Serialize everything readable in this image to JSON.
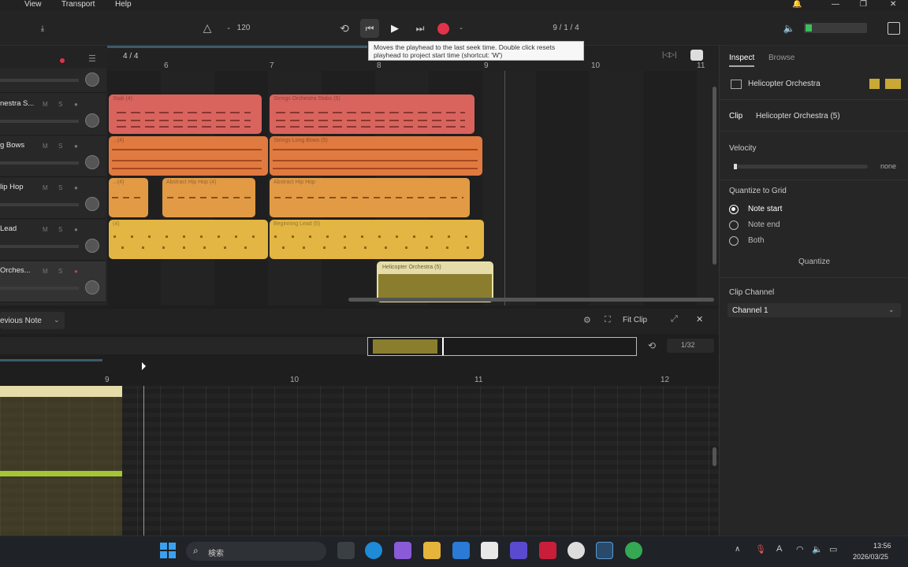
{
  "menu": [
    "View",
    "Transport",
    "Help"
  ],
  "toolbar": {
    "tempo": "120",
    "position": "9  /  1  /  4",
    "fit_clip": "Fit Clip",
    "time_sig": "4 / 4"
  },
  "tooltip": "Moves the playhead to the last seek time. Double click resets playhead to project start time (shortcut: 'W')",
  "ruler_marks": [
    "6",
    "7",
    "8",
    "9",
    "10",
    "11"
  ],
  "tracks": [
    {
      "name": "",
      "color": "#d46060"
    },
    {
      "name": "nestra S...",
      "color": "#d46060"
    },
    {
      "name": "g Bows",
      "color": "#e07a40"
    },
    {
      "name": "lip Hop",
      "color": "#e5953e"
    },
    {
      "name": "Lead",
      "color": "#e0b23a"
    },
    {
      "name": "Orches...",
      "color": "#8c8030"
    }
  ],
  "clips": [
    {
      "label": "Stab (4)",
      "color": "#d9645e"
    },
    {
      "label": "Strings Orchestra Stabs (5)",
      "color": "#d9645e"
    },
    {
      "label": "...(4)",
      "color": "#e07a40"
    },
    {
      "label": "Strings Long Bows (5)",
      "color": "#e07a40"
    },
    {
      "label": "...(4)",
      "color": "#e29a45"
    },
    {
      "label": "Abstract Hip Hop (4)",
      "color": "#e29a45"
    },
    {
      "label": "Abstract Hip Hop",
      "color": "#e29a45"
    },
    {
      "label": "(4)",
      "color": "#e3b543"
    },
    {
      "label": "Beginning Lead (5)",
      "color": "#e3b543"
    },
    {
      "label": "Helicopter Orchestra (5)",
      "color": "#8a7e2e"
    }
  ],
  "editor": {
    "prev_note": "evious Note",
    "grid": "1/32",
    "bars": [
      "9",
      "10",
      "11",
      "12"
    ]
  },
  "inspector": {
    "tab_inspect": "Inspect",
    "tab_browse": "Browse",
    "track_name": "Helicopter Orchestra",
    "clip_label": "Clip",
    "clip_name": "Helicopter Orchestra (5)",
    "velocity_label": "Velocity",
    "velocity_value": "none",
    "quantize_label": "Quantize to Grid",
    "options": [
      "Note start",
      "Note end",
      "Both"
    ],
    "quantize_button": "Quantize",
    "channel_label": "Clip Channel",
    "channel_value": "Channel 1"
  },
  "taskbar": {
    "search": "検索",
    "time": "13:56",
    "date": "2026/03/25"
  }
}
